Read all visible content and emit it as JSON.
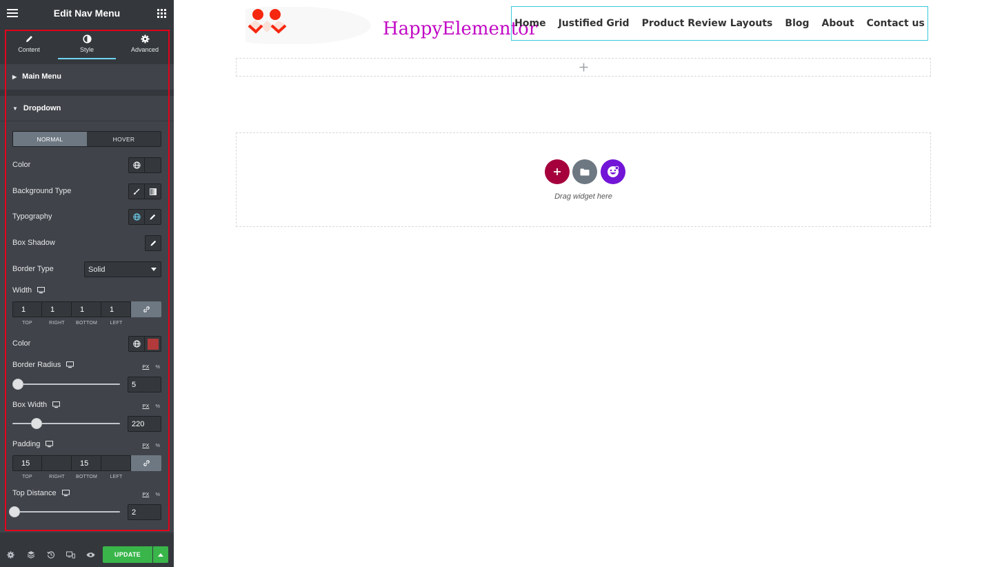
{
  "panel": {
    "title": "Edit Nav Menu",
    "tabs": [
      {
        "label": "Content",
        "icon": "pencil-icon"
      },
      {
        "label": "Style",
        "icon": "half-circle-icon",
        "active": true
      },
      {
        "label": "Advanced",
        "icon": "gear-icon"
      }
    ],
    "sections": {
      "main_menu": "Main Menu",
      "dropdown": "Dropdown"
    },
    "state_tabs": [
      "NORMAL",
      "HOVER"
    ],
    "controls": {
      "color": "Color",
      "background_type": "Background Type",
      "typography": "Typography",
      "box_shadow": "Box Shadow",
      "border_type": "Border Type",
      "border_type_value": "Solid",
      "width": "Width",
      "width_values": [
        "1",
        "1",
        "1",
        "1"
      ],
      "border_color": "Color",
      "border_color_swatch": "#b23a3a",
      "border_radius": "Border Radius",
      "border_radius_value": "5",
      "box_width": "Box Width",
      "box_width_value": "220",
      "padding": "Padding",
      "padding_values": [
        "15",
        "",
        "15",
        ""
      ],
      "top_distance": "Top Distance",
      "top_distance_value": "2"
    },
    "dimension_labels": [
      "TOP",
      "RIGHT",
      "BOTTOM",
      "LEFT"
    ],
    "units": {
      "px": "PX",
      "pct": "%"
    },
    "footer": {
      "update": "UPDATE"
    },
    "accent_color": "#71d7f7",
    "update_color": "#39b54a"
  },
  "canvas": {
    "logo_text": "HappyElementor",
    "nav": [
      "Home",
      "Justified Grid",
      "Product Review Layouts",
      "Blog",
      "About",
      "Contact us"
    ],
    "drag_text": "Drag widget here",
    "colors": {
      "logo": "#c108c4",
      "nav_border": "#39c7dc",
      "add_btn": "#a5003c",
      "template_btn": "#6d7882",
      "happy_btn": "#7215d7"
    }
  }
}
